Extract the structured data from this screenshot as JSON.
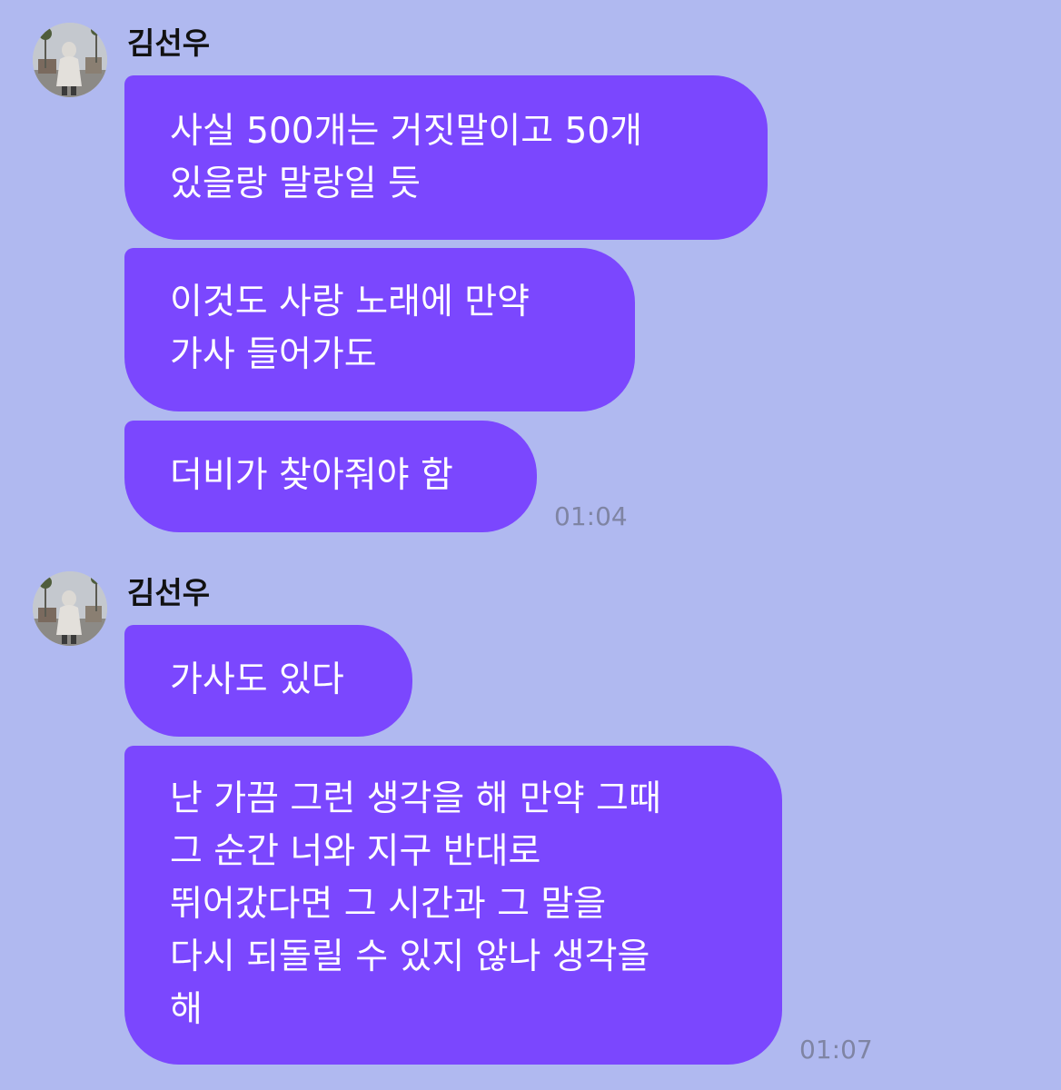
{
  "chat": {
    "background_color": "#b0b9f0",
    "bubble_color": "#7b47fe",
    "groups": [
      {
        "sender": "김선우",
        "avatar": "profile-photo",
        "messages": [
          {
            "lines": [
              "사실 500개는 거짓말이고 50개",
              "있을랑 말랑일 듯"
            ]
          },
          {
            "lines": [
              "이것도 사랑 노래에 만약",
              "가사 들어가도"
            ]
          },
          {
            "lines": [
              "더비가 찾아줘야 함"
            ]
          }
        ],
        "time": "01:04"
      },
      {
        "sender": "김선우",
        "avatar": "profile-photo",
        "messages": [
          {
            "lines": [
              "가사도 있다"
            ]
          },
          {
            "lines": [
              "난 가끔 그런 생각을 해 만약 그때",
              "그 순간 너와 지구 반대로",
              "뛰어갔다면 그 시간과 그 말을",
              "다시 되돌릴 수 있지 않나 생각을",
              "해"
            ]
          }
        ],
        "time": "01:07"
      }
    ]
  }
}
